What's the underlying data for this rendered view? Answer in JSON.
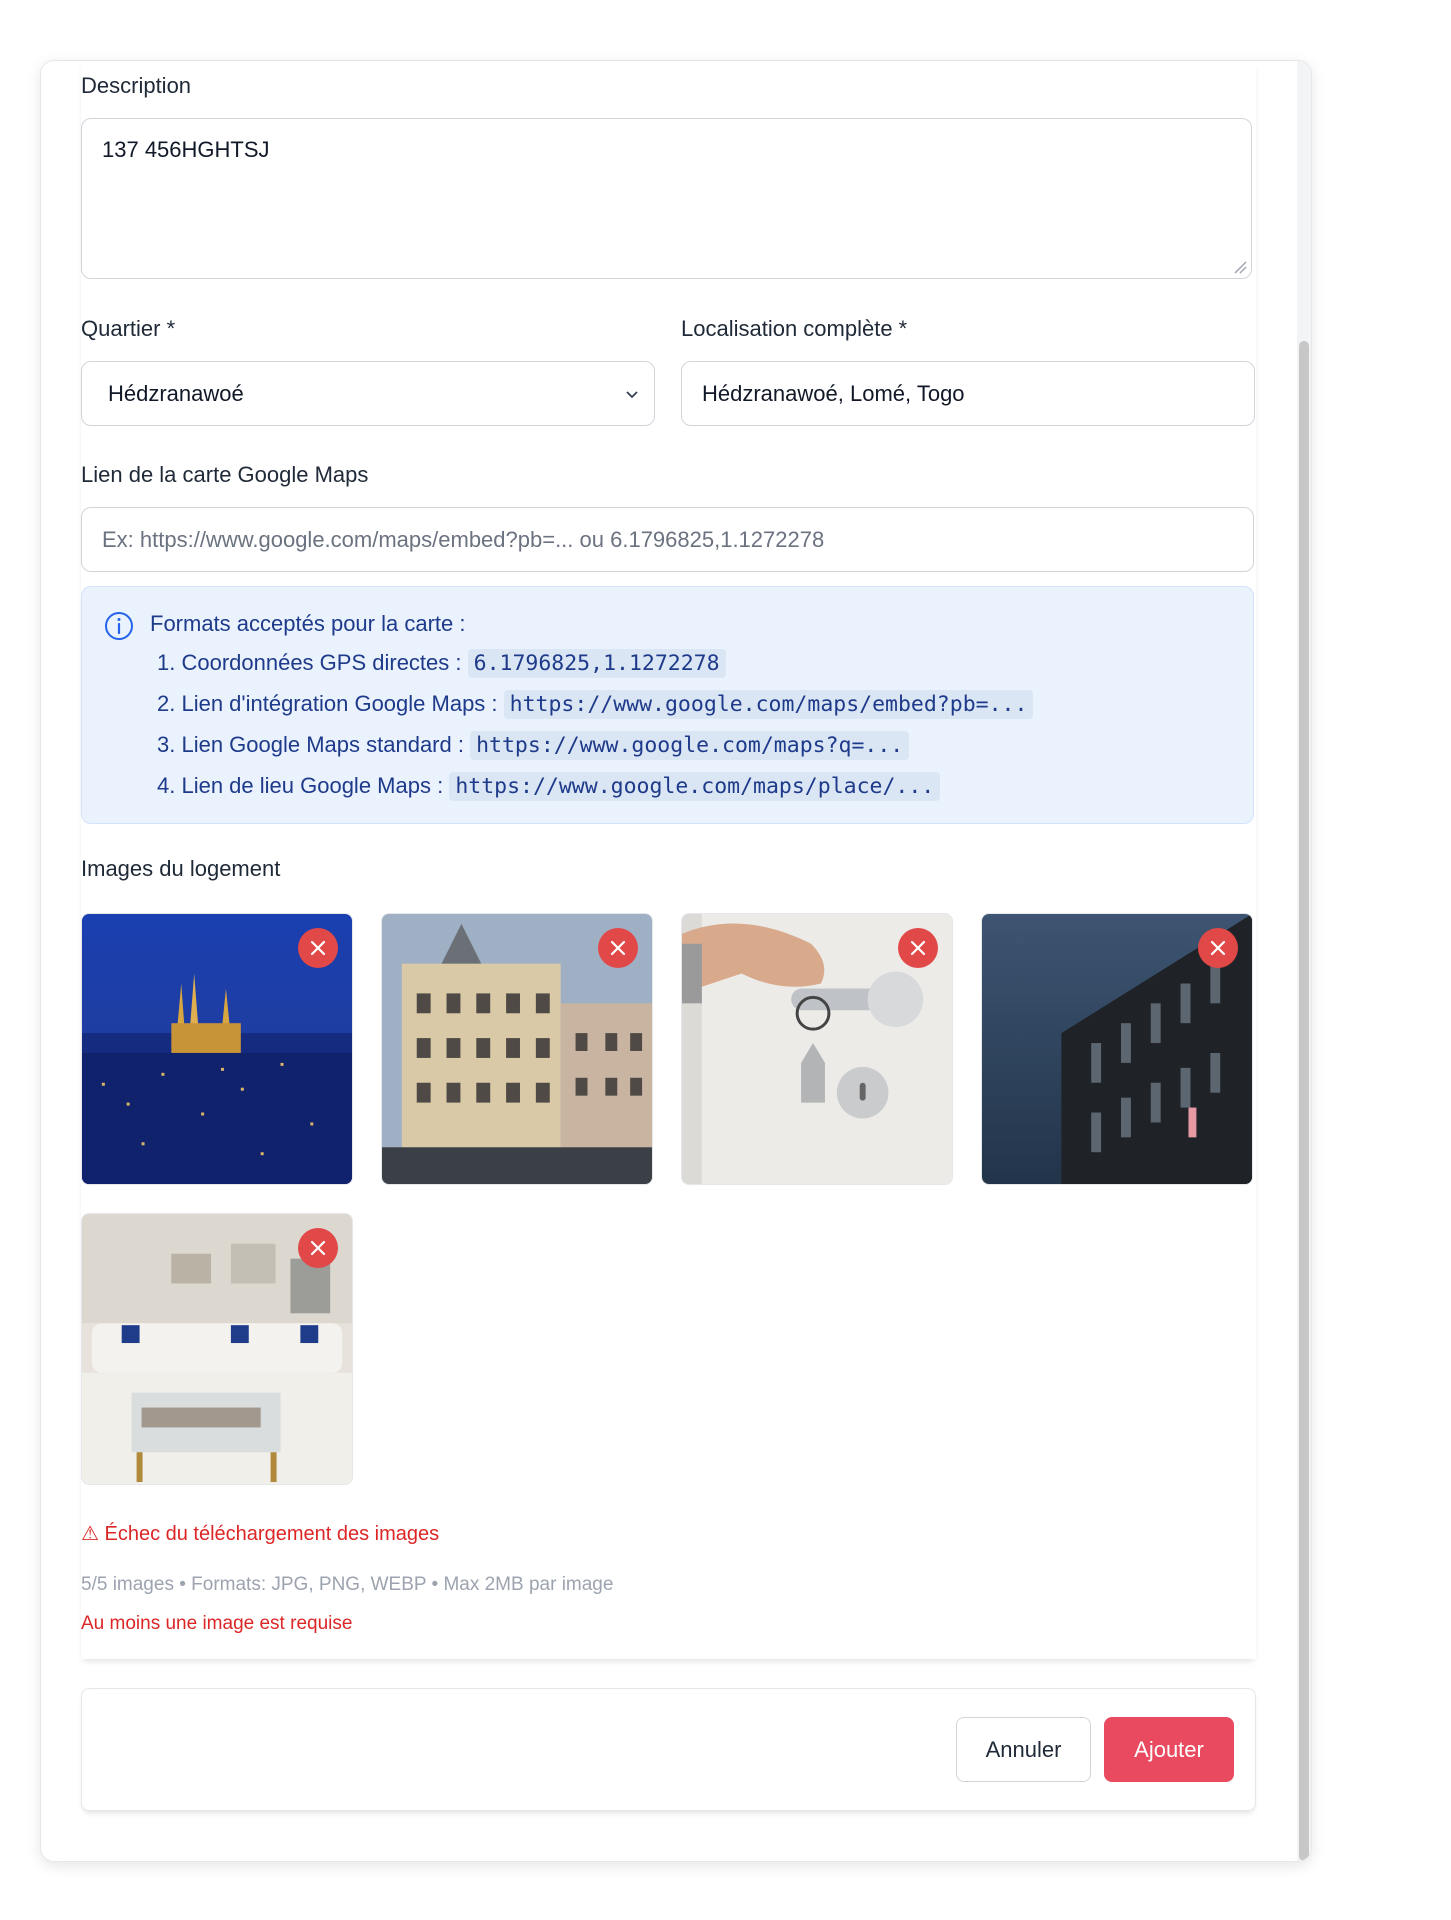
{
  "description": {
    "label": "Description",
    "value": "137 456HGHTSJ"
  },
  "quartier": {
    "label": "Quartier *",
    "selected": "Hédzranawoé"
  },
  "localisation": {
    "label": "Localisation complète *",
    "value": "Hédzranawoé, Lomé, Togo"
  },
  "maps_link": {
    "label": "Lien de la carte Google Maps",
    "placeholder": "Ex: https://www.google.com/maps/embed?pb=... ou 6.1796825,1.1272278"
  },
  "formats_info": {
    "title": "Formats acceptés pour la carte :",
    "items": [
      {
        "text": "1. Coordonnées GPS directes :",
        "code": "6.1796825,1.1272278"
      },
      {
        "text": "2. Lien d'intégration Google Maps :",
        "code": "https://www.google.com/maps/embed?pb=..."
      },
      {
        "text": "3. Lien Google Maps standard :",
        "code": "https://www.google.com/maps?q=..."
      },
      {
        "text": "4. Lien de lieu Google Maps :",
        "code": "https://www.google.com/maps/place/..."
      }
    ]
  },
  "images": {
    "label": "Images du logement",
    "thumbnails": [
      "city-night-castle",
      "ornate-building",
      "hand-key-door",
      "dark-building-facade",
      "living-room"
    ]
  },
  "upload_error": "⚠ Échec du téléchargement des images",
  "upload_hint": "5/5 images • Formats: JPG, PNG, WEBP • Max 2MB par image",
  "validation_error": "Au moins une image est requise",
  "footer": {
    "cancel_label": "Annuler",
    "submit_label": "Ajouter"
  },
  "colors": {
    "accent": "#ea4a5f",
    "remove": "#e14848",
    "error": "#dc2626",
    "info_bg": "#eaf2fd"
  }
}
